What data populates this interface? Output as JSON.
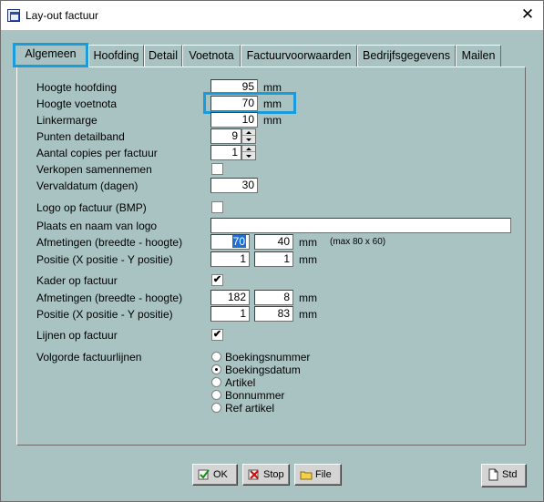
{
  "window": {
    "title": "Lay-out factuur",
    "close_glyph": "✕"
  },
  "tabs": [
    "Algemeen",
    "Hoofding",
    "Detail",
    "Voetnota",
    "Factuurvoorwaarden",
    "Bedrijfsgegevens",
    "Mailen"
  ],
  "active_tab": "Algemeen",
  "fields": {
    "hoogte_hoofding": {
      "label": "Hoogte hoofding",
      "value": "95",
      "unit": "mm"
    },
    "hoogte_voetnota": {
      "label": "Hoogte voetnota",
      "value": "70",
      "unit": "mm"
    },
    "linkermarge": {
      "label": "Linkermarge",
      "value": "10",
      "unit": "mm"
    },
    "punten_detailband": {
      "label": "Punten detailband",
      "value": "9"
    },
    "aantal_copies": {
      "label": "Aantal copies per factuur",
      "value": "1"
    },
    "verkopen_samennemen": {
      "label": "Verkopen samennemen",
      "checked": false
    },
    "vervaldatum": {
      "label": "Vervaldatum (dagen)",
      "value": "30"
    },
    "logo_op_factuur": {
      "label": "Logo op factuur (BMP)",
      "checked": false
    },
    "plaats_logo": {
      "label": "Plaats en naam van logo",
      "value": ""
    },
    "logo_afmetingen": {
      "label": "Afmetingen (breedte - hoogte)",
      "breedte": "70",
      "hoogte": "40",
      "unit": "mm",
      "note": "(max 80 x 60)"
    },
    "logo_positie": {
      "label": "Positie (X positie - Y positie)",
      "x": "1",
      "y": "1",
      "unit": "mm"
    },
    "kader_op_factuur": {
      "label": "Kader op factuur",
      "checked": true
    },
    "kader_afmetingen": {
      "label": "Afmetingen (breedte - hoogte)",
      "breedte": "182",
      "hoogte": "8",
      "unit": "mm"
    },
    "kader_positie": {
      "label": "Positie (X positie - Y positie)",
      "x": "1",
      "y": "83",
      "unit": "mm"
    },
    "lijnen_op_factuur": {
      "label": "Lijnen op factuur",
      "checked": true
    }
  },
  "volgorde": {
    "label": "Volgorde factuurlijnen",
    "options": [
      "Boekingsnummer",
      "Boekingsdatum",
      "Artikel",
      "Bonnummer",
      "Ref artikel"
    ],
    "selected": "Boekingsdatum"
  },
  "buttons": {
    "ok": "OK",
    "stop": "Stop",
    "file": "File",
    "std": "Std"
  },
  "check_glyph": "✔",
  "colors": {
    "panel_bg": "#a9c3c3",
    "highlight": "#1a9bdc",
    "selection": "#1e6fd0"
  }
}
